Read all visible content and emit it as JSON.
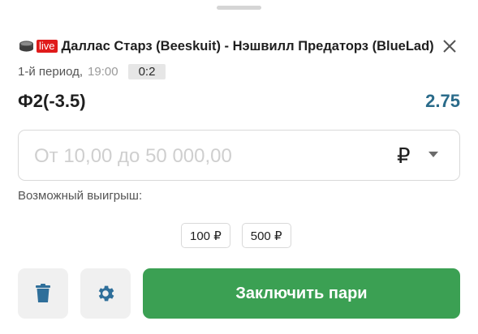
{
  "match": {
    "live_label": "live",
    "title": "Даллас Старз (Beeskuit) - Нэшвилл Предаторз (BlueLad)",
    "sport_icon": "hockey-icon",
    "close_icon": "close-icon"
  },
  "period": {
    "label": "1-й период,",
    "time": "19:00",
    "score": "0:2"
  },
  "bet": {
    "name": "Ф2(-3.5)",
    "odds": "2.75"
  },
  "stake": {
    "placeholder": "От 10,00 до 50 000,00",
    "value": "",
    "currency": "₽",
    "currency_dropdown_icon": "chevron-down-icon"
  },
  "possible_win_label": "Возможный выигрыш:",
  "quick_stakes": [
    "100 ₽",
    "500 ₽"
  ],
  "actions": {
    "trash_icon": "trash-icon",
    "settings_icon": "gear-icon",
    "place_bet_label": "Заключить пари"
  },
  "colors": {
    "live_badge": "#e01b1b",
    "odds": "#2a6b8a",
    "primary_button": "#3ba053",
    "icon_blue": "#2f6f9a"
  }
}
